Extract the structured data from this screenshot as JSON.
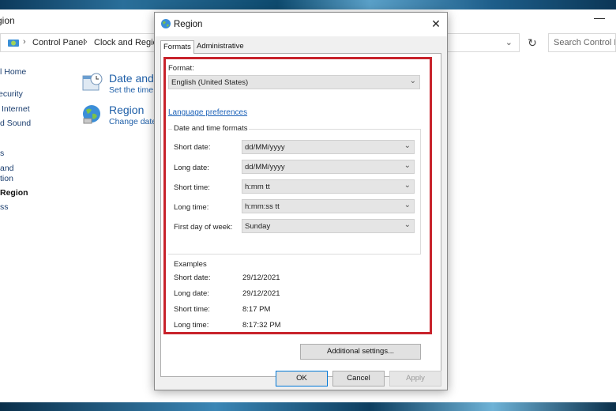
{
  "control_panel": {
    "title": "gion",
    "breadcrumb": [
      "Control Panel",
      "Clock and Region"
    ],
    "search_placeholder": "Search Control Pa",
    "left_nav": [
      "l Home",
      "ecurity",
      "Internet",
      "d Sound",
      "s",
      "and",
      "tion",
      "Region",
      "ss"
    ],
    "categories": [
      {
        "title": "Date and",
        "subtitle": "Set the time"
      },
      {
        "title": "Region",
        "subtitle": "Change date"
      }
    ]
  },
  "dialog": {
    "title": "Region",
    "close_glyph": "✕",
    "tabs": [
      "Formats",
      "Administrative"
    ],
    "format_label": "Format:",
    "format_value": "English (United States)",
    "language_link": "Language preferences",
    "group_title": "Date and time formats",
    "fields": [
      {
        "label": "Short date:",
        "value": "dd/MM/yyyy"
      },
      {
        "label": "Long date:",
        "value": "dd/MM/yyyy"
      },
      {
        "label": "Short time:",
        "value": "h:mm tt"
      },
      {
        "label": "Long time:",
        "value": "h:mm:ss tt"
      },
      {
        "label": "First day of week:",
        "value": "Sunday"
      }
    ],
    "examples_title": "Examples",
    "examples": [
      {
        "label": "Short date:",
        "value": "29/12/2021"
      },
      {
        "label": "Long date:",
        "value": "29/12/2021"
      },
      {
        "label": "Short time:",
        "value": "8:17 PM"
      },
      {
        "label": "Long time:",
        "value": "8:17:32 PM"
      }
    ],
    "additional_settings": "Additional settings...",
    "buttons": {
      "ok": "OK",
      "cancel": "Cancel",
      "apply": "Apply"
    }
  },
  "colors": {
    "highlight": "#c8232c",
    "link": "#1d62b8",
    "accent": "#0078d7"
  },
  "icons": [
    "globe-icon",
    "close-icon",
    "chevron-down-icon",
    "refresh-icon",
    "clock-icon"
  ]
}
